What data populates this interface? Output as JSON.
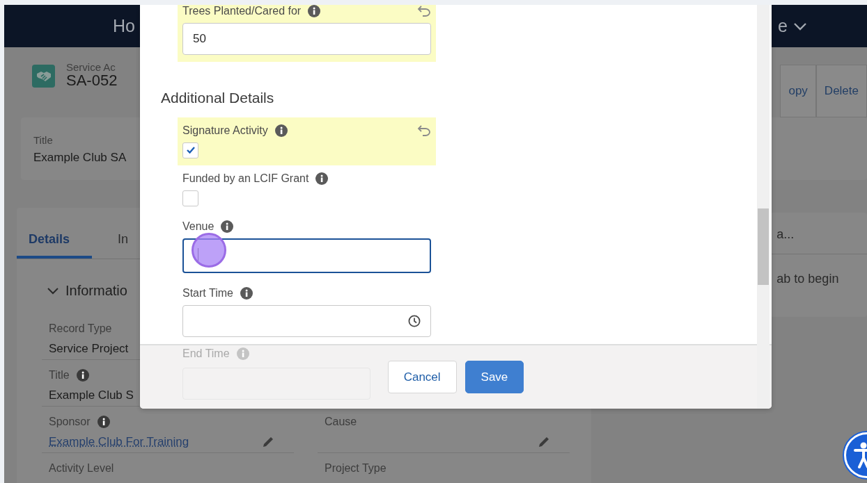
{
  "top_bar": {
    "title": "Ho",
    "menu_label": "e"
  },
  "record_header": {
    "object_label": "Service Ac",
    "record_name": "SA-052",
    "actions": [
      "opy",
      "Delete"
    ]
  },
  "highlights": {
    "label": "Title",
    "value": "Example Club SA"
  },
  "tabs": [
    {
      "label": "Details",
      "selected": true
    },
    {
      "label": "In",
      "selected": false
    }
  ],
  "section": {
    "title": "Informatio",
    "expanded": true
  },
  "field_rows": [
    {
      "left": {
        "label": "Record Type",
        "value": "Service Project",
        "info": false,
        "editable": false,
        "link": false
      }
    },
    {
      "left": {
        "label": "Title",
        "value": "Example Club S",
        "info": true,
        "editable": false,
        "link": false
      }
    },
    {
      "left": {
        "label": "Sponsor",
        "value": "Example Club For Training",
        "info": true,
        "editable": true,
        "link": true
      },
      "right": {
        "label": "Cause",
        "info": false,
        "editable": true,
        "link": false
      }
    },
    {
      "left": {
        "label": "Activity Level",
        "info": false,
        "editable": false,
        "link": false
      },
      "right": {
        "label": "Project Type",
        "info": false,
        "editable": false,
        "link": false
      }
    }
  ],
  "side_card": {
    "tab_label": "a...",
    "message": "ab to begin"
  },
  "modal": {
    "items": [
      {
        "kind": "text_input",
        "label": "Trees Planted/Cared for",
        "info": true,
        "changed": true,
        "value": "50",
        "focused": false
      },
      {
        "kind": "heading",
        "label": "Additional Details"
      },
      {
        "kind": "checkbox",
        "label": "Signature Activity",
        "info": true,
        "changed": true,
        "checked": true
      },
      {
        "kind": "checkbox",
        "label": "Funded by an LCIF Grant",
        "info": true,
        "changed": false,
        "checked": false
      },
      {
        "kind": "text_input",
        "label": "Venue",
        "info": true,
        "changed": false,
        "focused": true
      },
      {
        "kind": "time_input",
        "label": "Start Time",
        "info": true,
        "changed": false,
        "focused": false
      }
    ],
    "hidden_field": {
      "label": "End Time",
      "info": true
    },
    "buttons": [
      {
        "label": "Cancel",
        "kind": "neutral"
      },
      {
        "label": "Save",
        "kind": "brand"
      }
    ]
  }
}
